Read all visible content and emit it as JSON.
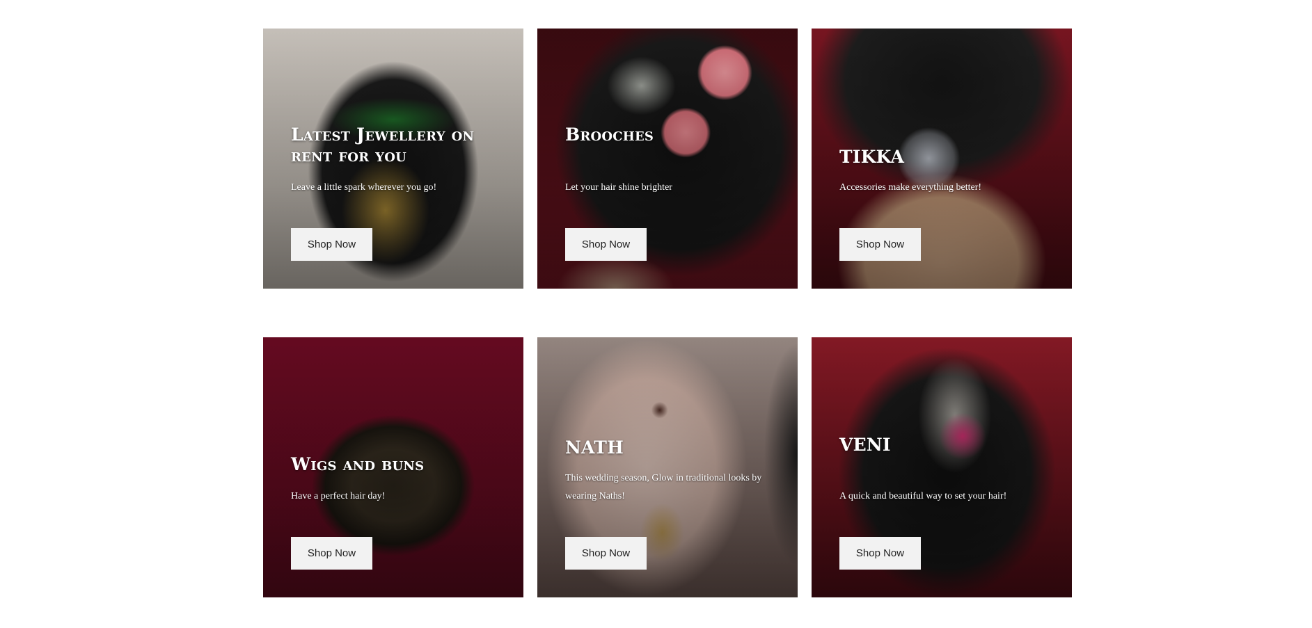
{
  "cards": [
    {
      "title": "Latest Jewellery on rent for you",
      "description": "Leave a little spark wherever you go!",
      "button_label": "Shop Now"
    },
    {
      "title": "Brooches",
      "description": "Let your hair shine brighter",
      "button_label": "Shop Now"
    },
    {
      "title": "TIKKA",
      "description": "Accessories make everything better!",
      "button_label": "Shop Now"
    },
    {
      "title": "Wigs and buns",
      "description": "Have a perfect hair day!",
      "button_label": "Shop Now"
    },
    {
      "title": "NATH",
      "description": "This wedding season, Glow in traditional looks by wearing Naths!",
      "button_label": "Shop Now"
    },
    {
      "title": "VENI",
      "description": "A quick and beautiful way to set your hair!",
      "button_label": "Shop Now"
    }
  ]
}
